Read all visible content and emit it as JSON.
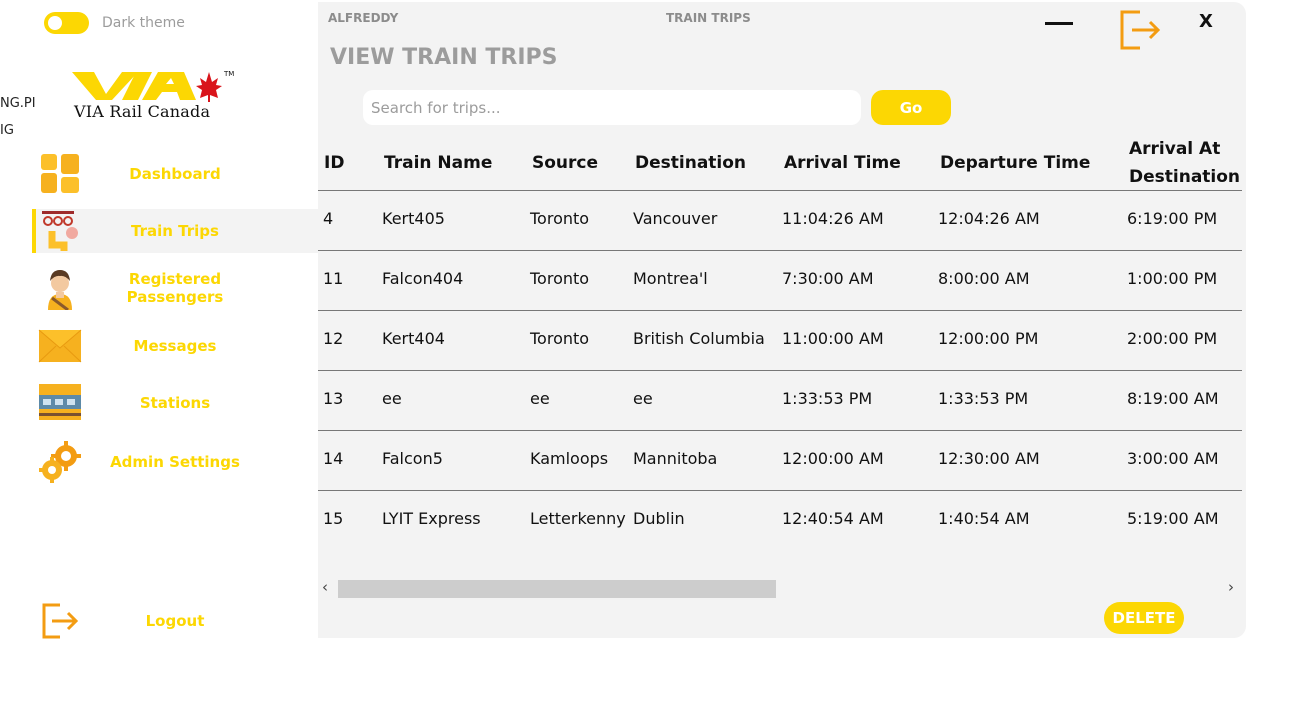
{
  "stray_text": [
    "NG.PI",
    "IG"
  ],
  "theme_toggle": {
    "label": "Dark theme"
  },
  "logo": {
    "text": "VIA Rail Canada",
    "mark": "VIA"
  },
  "sidebar": {
    "items": [
      {
        "label": "Dashboard",
        "icon": "dashboard-icon"
      },
      {
        "label": "Train Trips",
        "icon": "train-icon",
        "active": true
      },
      {
        "label": "Registered Passengers",
        "icon": "passenger-icon"
      },
      {
        "label": "Messages",
        "icon": "envelope-icon"
      },
      {
        "label": "Stations",
        "icon": "station-icon"
      },
      {
        "label": "Admin Settings",
        "icon": "gear-icon"
      }
    ],
    "logout": {
      "label": "Logout",
      "icon": "logout-icon"
    }
  },
  "header": {
    "user": "ALFREDDY",
    "section": "TRAIN TRIPS",
    "close": "X"
  },
  "page_title": "VIEW TRAIN TRIPS",
  "search": {
    "placeholder": "Search for trips...",
    "value": ""
  },
  "go_label": "Go",
  "table": {
    "columns": [
      "ID",
      "Train Name",
      "Source",
      "Destination",
      "Arrival Time",
      "Departure Time",
      "Arrival At Destination"
    ],
    "rows": [
      [
        "4",
        "Kert405",
        "Toronto",
        "Vancouver",
        "11:04:26 AM",
        "12:04:26 AM",
        "6:19:00 PM"
      ],
      [
        "11",
        "Falcon404",
        "Toronto",
        "Montrea'l",
        "7:30:00 AM",
        "8:00:00 AM",
        "1:00:00 PM"
      ],
      [
        "12",
        "Kert404",
        "Toronto",
        "British Columbia",
        "11:00:00 AM",
        "12:00:00 PM",
        "2:00:00 PM"
      ],
      [
        "13",
        "ee",
        "ee",
        "ee",
        "1:33:53 PM",
        "1:33:53 PM",
        "8:19:00 AM"
      ],
      [
        "14",
        "Falcon5",
        "Kamloops",
        "Mannitoba",
        "12:00:00 AM",
        "12:30:00 AM",
        "3:00:00 AM"
      ],
      [
        "15",
        "LYIT Express",
        "Letterkenny",
        "Dublin",
        "12:40:54 AM",
        "1:40:54 AM",
        "5:19:00 AM"
      ]
    ]
  },
  "delete_label": "DELETE",
  "colors": {
    "accent": "#fcd703",
    "orange": "#f39c12",
    "panel": "#f3f3f3"
  }
}
